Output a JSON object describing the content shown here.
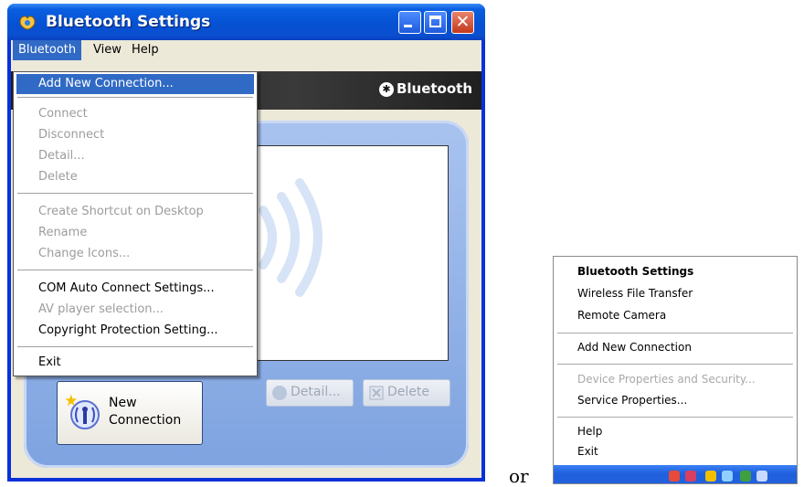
{
  "window": {
    "title": "Bluetooth Settings",
    "close_glyph": "✕"
  },
  "menubar": {
    "items": [
      "Bluetooth",
      "View",
      "Help"
    ]
  },
  "banner": {
    "logo_text": "Bluetooth",
    "logo_glyph": "✱"
  },
  "dropdown": {
    "items": [
      {
        "label": "Add New Connection...",
        "state": "highlighted"
      },
      {
        "label": "Connect",
        "state": "disabled"
      },
      {
        "label": "Disconnect",
        "state": "disabled"
      },
      {
        "label": "Detail...",
        "state": "disabled"
      },
      {
        "label": "Delete",
        "state": "disabled"
      },
      {
        "label": "Create Shortcut on Desktop",
        "state": "disabled"
      },
      {
        "label": "Rename",
        "state": "disabled"
      },
      {
        "label": "Change Icons...",
        "state": "disabled"
      },
      {
        "label": "COM Auto Connect Settings...",
        "state": "enabled"
      },
      {
        "label": "AV player selection...",
        "state": "disabled"
      },
      {
        "label": "Copyright Protection Setting...",
        "state": "enabled"
      },
      {
        "label": "Exit",
        "state": "enabled"
      }
    ]
  },
  "buttons": {
    "new_connection": "New Connection",
    "detail": "Detail...",
    "delete": "Delete"
  },
  "separator_word": "or",
  "tray_menu": {
    "items": [
      {
        "label": "Bluetooth Settings",
        "state": "bold"
      },
      {
        "label": "Wireless File Transfer",
        "state": "enabled"
      },
      {
        "label": "Remote Camera",
        "state": "enabled"
      },
      {
        "label": "Add New Connection",
        "state": "enabled"
      },
      {
        "label": "Device Properties and Security...",
        "state": "disabled"
      },
      {
        "label": "Service Properties...",
        "state": "enabled"
      },
      {
        "label": "Help",
        "state": "enabled"
      },
      {
        "label": "Exit",
        "state": "enabled"
      }
    ]
  },
  "colors": {
    "title_blue": "#0552d3",
    "menu_highlight": "#316ac5",
    "panel_blue": "#7ea3e0",
    "close_red": "#c3391d"
  }
}
